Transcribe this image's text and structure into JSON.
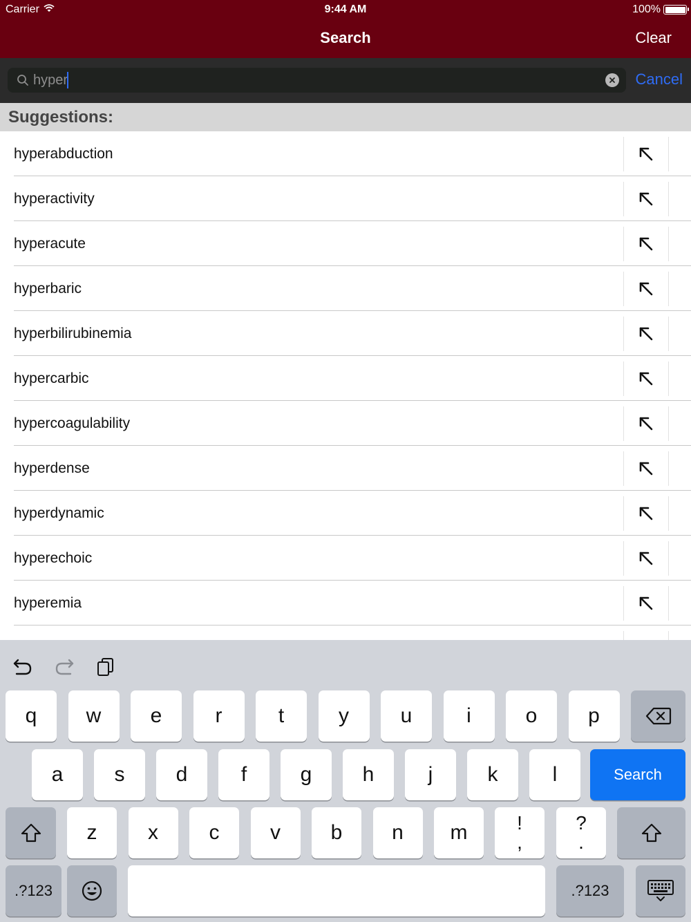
{
  "status": {
    "carrier": "Carrier",
    "time": "9:44 AM",
    "battery": "100%",
    "battery_level": 1.0
  },
  "nav": {
    "title": "Search",
    "clear_label": "Clear"
  },
  "search": {
    "value": "hyper",
    "cancel_label": "Cancel"
  },
  "suggestions": {
    "header": "Suggestions:",
    "items": [
      {
        "label": "hyperabduction"
      },
      {
        "label": "hyperactivity"
      },
      {
        "label": "hyperacute"
      },
      {
        "label": "hyperbaric"
      },
      {
        "label": "hyperbilirubinemia"
      },
      {
        "label": "hypercarbic"
      },
      {
        "label": "hypercoagulability"
      },
      {
        "label": "hyperdense"
      },
      {
        "label": "hyperdynamic"
      },
      {
        "label": "hyperechoic"
      },
      {
        "label": "hyperemia"
      },
      {
        "label": ""
      }
    ]
  },
  "keyboard": {
    "row1": [
      "q",
      "w",
      "e",
      "r",
      "t",
      "y",
      "u",
      "i",
      "o",
      "p"
    ],
    "row2": [
      "a",
      "s",
      "d",
      "f",
      "g",
      "h",
      "j",
      "k",
      "l"
    ],
    "row3": [
      "z",
      "x",
      "c",
      "v",
      "b",
      "n",
      "m"
    ],
    "punct1": {
      "top": "!",
      "bottom": ","
    },
    "punct2": {
      "top": "?",
      "bottom": "."
    },
    "search_label": "Search",
    "numbers_label": ".?123",
    "numbers_label_right": ".?123",
    "space_label": ""
  },
  "colors": {
    "nav_bg": "#690010",
    "accent": "#2f6cf5",
    "search_key": "#0f74f3"
  }
}
